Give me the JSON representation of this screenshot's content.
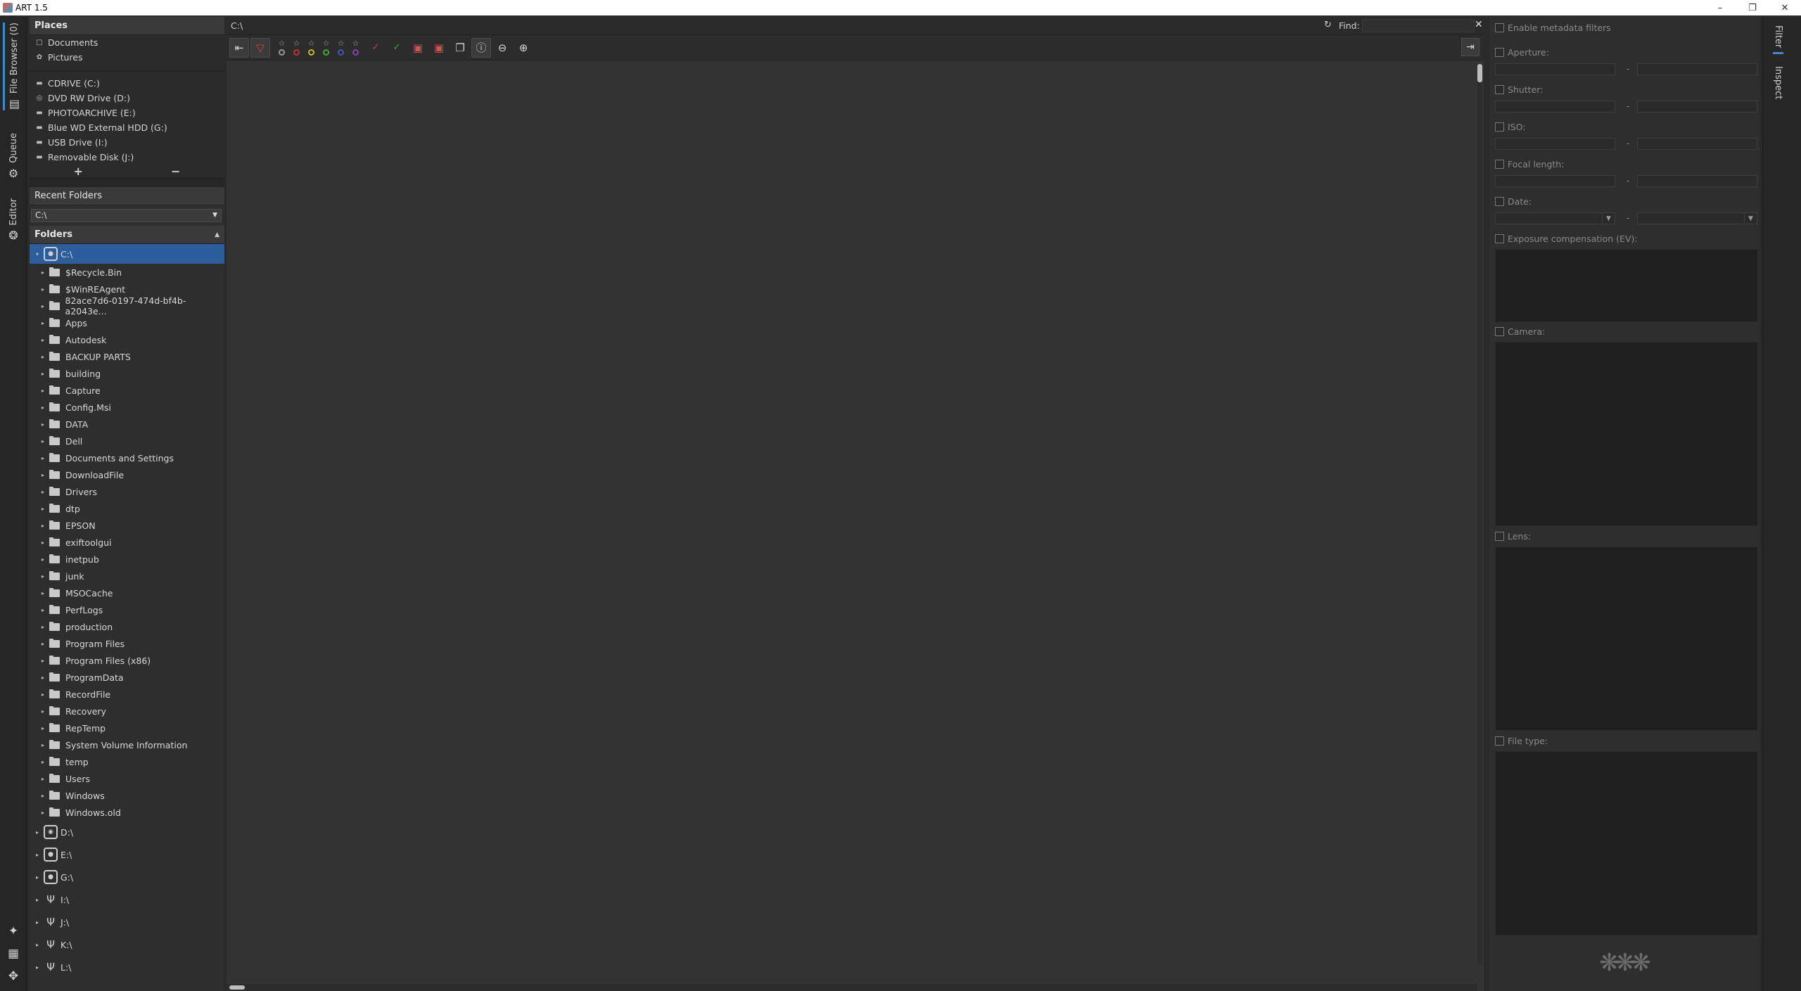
{
  "window": {
    "title": "ART 1.5",
    "minimize": "–",
    "restore": "❐",
    "close": "✕"
  },
  "left_tabs": [
    {
      "label": "File Browser (0)",
      "icon": "folder-icon"
    },
    {
      "label": "Queue",
      "icon": "gears-icon"
    },
    {
      "label": "Editor",
      "icon": "aperture-icon"
    }
  ],
  "places": {
    "header": "Places",
    "items": [
      {
        "label": "Documents",
        "icon": "document-icon"
      },
      {
        "label": "Pictures",
        "icon": "picture-icon"
      }
    ],
    "drives": [
      {
        "label": "CDRIVE (C:)"
      },
      {
        "label": "DVD RW Drive (D:)"
      },
      {
        "label": "PHOTOARCHIVE (E:)"
      },
      {
        "label": "Blue WD External HDD (G:)"
      },
      {
        "label": "USB Drive (I:)"
      },
      {
        "label": "Removable Disk (J:)"
      }
    ],
    "add": "+",
    "remove": "−"
  },
  "recent": {
    "header": "Recent Folders",
    "value": "C:\\"
  },
  "folders": {
    "header": "Folders",
    "root": "C:\\",
    "children": [
      "$Recycle.Bin",
      "$WinREAgent",
      "82ace7d6-0197-474d-bf4b-a2043e...",
      "Apps",
      "Autodesk",
      "BACKUP PARTS",
      "building",
      "Capture",
      "Config.Msi",
      "DATA",
      "Dell",
      "Documents and Settings",
      "DownloadFile",
      "Drivers",
      "dtp",
      "EPSON",
      "exiftoolgui",
      "inetpub",
      "junk",
      "MSOCache",
      "PerfLogs",
      "production",
      "Program Files",
      "Program Files (x86)",
      "ProgramData",
      "RecordFile",
      "Recovery",
      "RepTemp",
      "System Volume Information",
      "temp",
      "Users",
      "Windows",
      "Windows.old"
    ],
    "other_drives": [
      {
        "label": "D:\\",
        "type": "optical"
      },
      {
        "label": "E:\\",
        "type": "hdd"
      },
      {
        "label": "G:\\",
        "type": "hdd"
      },
      {
        "label": "I:\\",
        "type": "usb"
      },
      {
        "label": "J:\\",
        "type": "usb"
      },
      {
        "label": "K:\\",
        "type": "usb"
      },
      {
        "label": "L:\\",
        "type": "usb"
      }
    ]
  },
  "pathbar": {
    "path": "C:\\",
    "find_label": "Find:",
    "find_value": ""
  },
  "filter": {
    "enable": "Enable metadata filters",
    "aperture": "Aperture:",
    "shutter": "Shutter:",
    "iso": "ISO:",
    "focal": "Focal length:",
    "date": "Date:",
    "exposure": "Exposure compensation (EV):",
    "camera": "Camera:",
    "lens": "Lens:",
    "filetype": "File type:",
    "dash": "-"
  },
  "right_tabs": [
    {
      "label": "Filter"
    },
    {
      "label": "Inspect"
    }
  ]
}
